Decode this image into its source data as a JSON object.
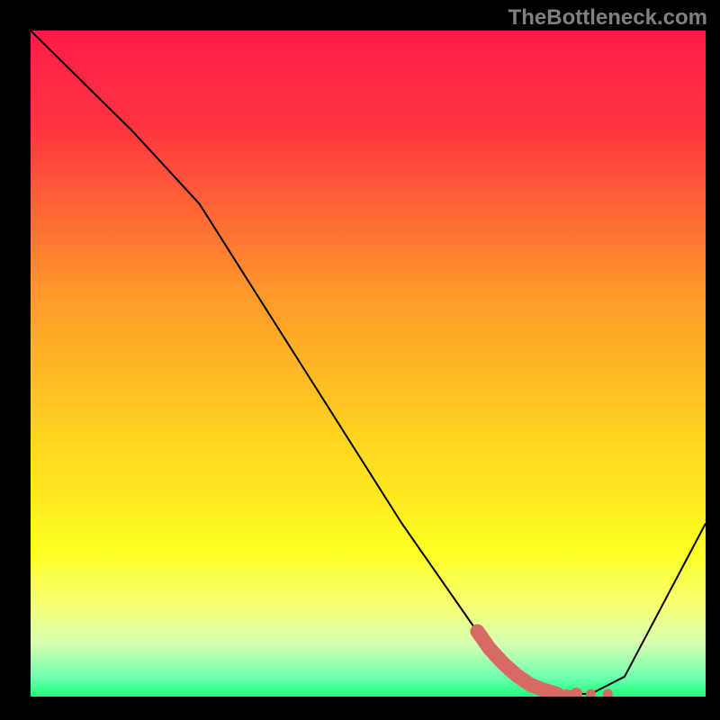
{
  "watermark": "TheBottleneck.com",
  "chart_data": {
    "type": "line",
    "xlim": [
      0,
      1
    ],
    "ylim": [
      0,
      1
    ],
    "title": "",
    "xlabel": "",
    "ylabel": "",
    "background_gradient_stops": [
      {
        "offset": 0.0,
        "color": "#ff1a48"
      },
      {
        "offset": 0.15,
        "color": "#ff3640"
      },
      {
        "offset": 0.4,
        "color": "#ff9a2a"
      },
      {
        "offset": 0.6,
        "color": "#ffd020"
      },
      {
        "offset": 0.78,
        "color": "#feff20"
      },
      {
        "offset": 0.86,
        "color": "#f7ff70"
      },
      {
        "offset": 0.92,
        "color": "#d8ffb0"
      },
      {
        "offset": 0.97,
        "color": "#70ffb0"
      },
      {
        "offset": 1.0,
        "color": "#1aff7a"
      }
    ],
    "series": [
      {
        "name": "curve",
        "x": [
          0.0,
          0.15,
          0.25,
          0.4,
          0.55,
          0.66,
          0.72,
          0.78,
          0.83,
          0.88,
          1.0
        ],
        "y": [
          1.0,
          0.85,
          0.74,
          0.5,
          0.26,
          0.1,
          0.03,
          0.004,
          0.004,
          0.03,
          0.26
        ],
        "stroke": "#000000",
        "stroke_width": 2
      },
      {
        "name": "highlight-blob",
        "x": [
          0.662,
          0.68,
          0.7,
          0.72,
          0.74,
          0.76,
          0.78,
          0.808,
          0.83,
          0.855
        ],
        "y": [
          0.098,
          0.072,
          0.05,
          0.032,
          0.018,
          0.01,
          0.004,
          0.004,
          0.004,
          0.004
        ],
        "stroke": "#d86a64",
        "type_hint": "thick-dotted"
      }
    ]
  }
}
